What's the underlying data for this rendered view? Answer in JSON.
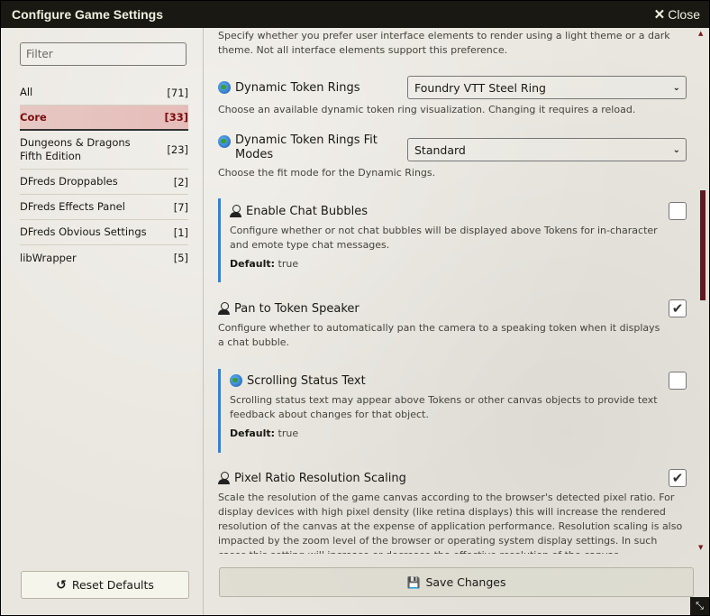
{
  "window": {
    "title": "Configure Game Settings",
    "close_label": "Close"
  },
  "sidebar": {
    "filter_placeholder": "Filter",
    "categories": [
      {
        "label": "All",
        "count": "[71]"
      },
      {
        "label": "Core",
        "count": "[33]"
      },
      {
        "label": "Dungeons & Dragons Fifth Edition",
        "count": "[23]"
      },
      {
        "label": "DFreds Droppables",
        "count": "[2]"
      },
      {
        "label": "DFreds Effects Panel",
        "count": "[7]"
      },
      {
        "label": "DFreds Obvious Settings",
        "count": "[1]"
      },
      {
        "label": "libWrapper",
        "count": "[5]"
      }
    ],
    "reset_label": "Reset Defaults"
  },
  "main": {
    "top_desc": "Specify whether you prefer user interface elements to render using a light theme or a dark theme. Not all interface elements support this preference.",
    "settings": {
      "rings": {
        "name": "Dynamic Token Rings",
        "value": "Foundry VTT Steel Ring",
        "desc": "Choose an available dynamic token ring visualization. Changing it requires a reload.",
        "scope_icon": "globe-icon"
      },
      "rings_fit": {
        "name": "Dynamic Token Rings Fit Modes",
        "value": "Standard",
        "desc": "Choose the fit mode for the Dynamic Rings.",
        "scope_icon": "globe-icon"
      },
      "chat_bubbles": {
        "name": "Enable Chat Bubbles",
        "desc": "Configure whether or not chat bubbles will be displayed above Tokens for in-character and emote type chat messages.",
        "default_label": "Default:",
        "default_value": " true",
        "checked": false,
        "scope_icon": "user-icon"
      },
      "pan_speaker": {
        "name": "Pan to Token Speaker",
        "desc": "Configure whether to automatically pan the camera to a speaking token when it displays a chat bubble.",
        "checked": true,
        "scope_icon": "user-icon"
      },
      "scroll_text": {
        "name": "Scrolling Status Text",
        "desc": "Scrolling status text may appear above Tokens or other canvas objects to provide text feedback about changes for that object.",
        "default_label": "Default:",
        "default_value": " true",
        "checked": false,
        "scope_icon": "globe-icon"
      },
      "pixel_ratio": {
        "name": "Pixel Ratio Resolution Scaling",
        "desc": "Scale the resolution of the game canvas according to the browser's detected pixel ratio. For display devices with high pixel density (like retina displays) this will increase the rendered resolution of the canvas at the expense of application performance. Resolution scaling is also impacted by the zoom level of the browser or operating system display settings. In such cases this setting will increase or decrease the effective resolution of the canvas independently of the zoom or display settings.",
        "checked": true,
        "scope_icon": "user-icon"
      }
    },
    "save_label": "Save Changes"
  }
}
